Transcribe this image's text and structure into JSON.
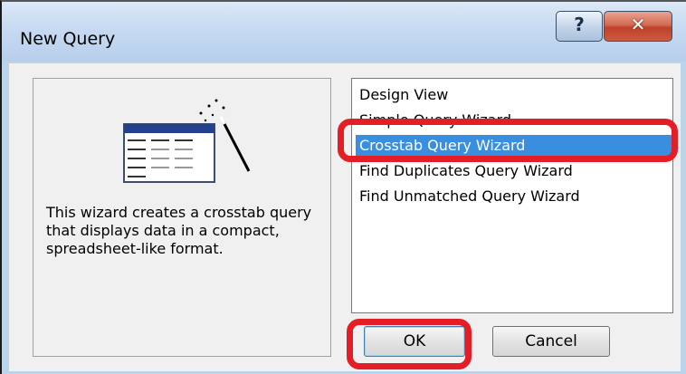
{
  "dialog": {
    "title": "New Query",
    "help_glyph": "?",
    "close_glyph": "✕"
  },
  "info": {
    "description": "This wizard creates a crosstab query that displays data in a compact, spreadsheet-like format.",
    "illustration_icon": "magic-wand-table-icon"
  },
  "query_types": [
    "Design View",
    "Simple Query Wizard",
    "Crosstab Query Wizard",
    "Find Duplicates Query Wizard",
    "Find Unmatched Query Wizard"
  ],
  "selected_query_type": "Crosstab Query Wizard",
  "buttons": {
    "ok": "OK",
    "cancel": "Cancel"
  },
  "colors": {
    "selection": "#3a8ee0",
    "annotation": "#e41e26"
  }
}
